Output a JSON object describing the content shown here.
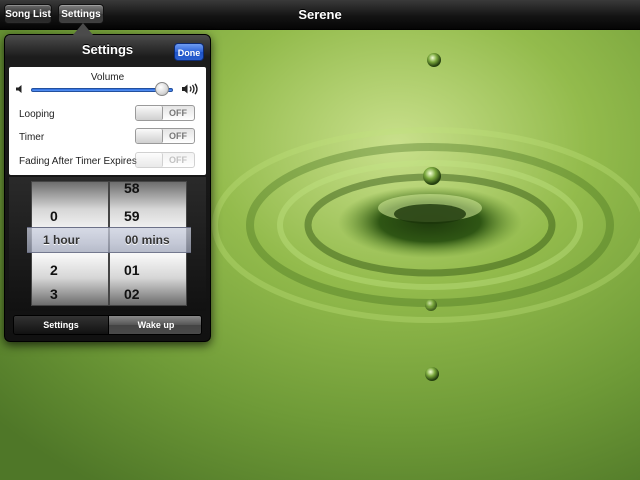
{
  "app": {
    "title": "Serene"
  },
  "topbar": {
    "song_list_label": "Song List",
    "settings_label": "Settings"
  },
  "popover": {
    "title": "Settings",
    "done_label": "Done",
    "volume": {
      "label": "Volume",
      "level": 0.92
    },
    "rows": [
      {
        "label": "Looping",
        "toggle": "OFF",
        "enabled": true
      },
      {
        "label": "Timer",
        "toggle": "OFF",
        "enabled": true
      },
      {
        "label": "Fading After Timer Expires",
        "toggle": "OFF",
        "enabled": false
      }
    ],
    "picker": {
      "hours": [
        "0",
        "1 hour",
        "2",
        "3"
      ],
      "minutes": [
        "58",
        "59",
        "00 mins",
        "01",
        "02"
      ],
      "selected_hour": "1 hour",
      "selected_minute": "00 mins"
    },
    "segments": {
      "settings_label": "Settings",
      "wakeup_label": "Wake up",
      "active": "Wake up"
    }
  },
  "colors": {
    "accent": "#2d63d7",
    "background_green": "#8fb04a"
  },
  "icons": {
    "volume_low": "speaker-low-icon",
    "volume_high": "speaker-high-icon"
  }
}
